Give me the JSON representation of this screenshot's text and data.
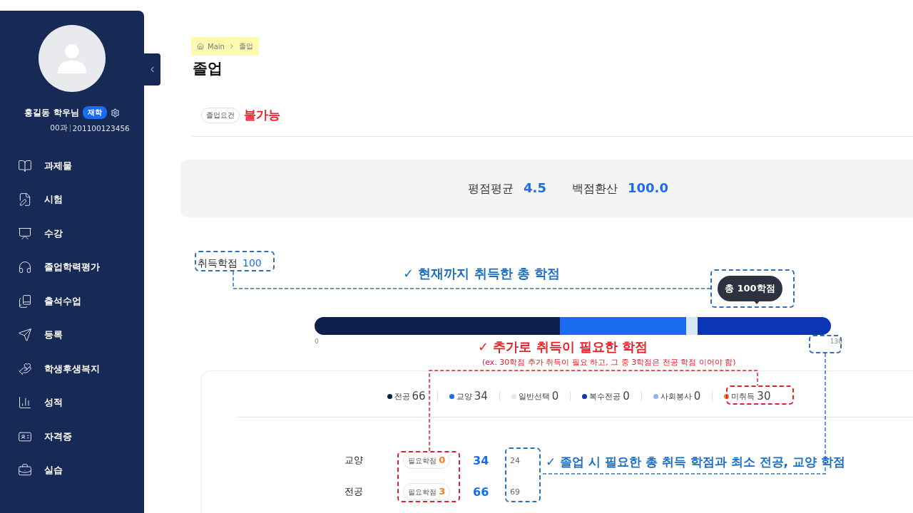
{
  "sidebar": {
    "profile": {
      "name": "홍길동 학우님",
      "badge": "재학",
      "department": "00과",
      "student_id": "201100123456"
    },
    "items": [
      {
        "label": "과제물"
      },
      {
        "label": "시험"
      },
      {
        "label": "수강"
      },
      {
        "label": "졸업학력평가"
      },
      {
        "label": "출석수업"
      },
      {
        "label": "등록"
      },
      {
        "label": "학생후생복지"
      },
      {
        "label": "성적"
      },
      {
        "label": "자격증"
      },
      {
        "label": "실습"
      }
    ]
  },
  "breadcrumb": [
    "Main",
    "졸업"
  ],
  "title": "졸업",
  "requirement": {
    "label": "졸업요건",
    "status": "불가능"
  },
  "grades": [
    {
      "label": "평점평균",
      "value": "4.5"
    },
    {
      "label": "백점환산",
      "value": "100.0"
    }
  ],
  "credits": {
    "label": "취득학점",
    "value": "100",
    "tooltip": "총 100학점",
    "min": "0",
    "max": "130",
    "segments": [
      {
        "color": "#0e1f4d"
      },
      {
        "color": "#1a6cf0"
      },
      {
        "color": "#d8e8fb"
      },
      {
        "color": "#0b35b5"
      }
    ]
  },
  "legend": [
    {
      "label": "전공",
      "value": "66",
      "color": "#0e1f4d"
    },
    {
      "label": "교양",
      "value": "34",
      "color": "#1a6cf0"
    },
    {
      "label": "일반선택",
      "value": "0",
      "color": "#d8e8fb"
    },
    {
      "label": "복수전공",
      "value": "0",
      "color": "#0b35b5"
    },
    {
      "label": "사회봉사",
      "value": "0",
      "color": "#8ab8f0"
    },
    {
      "label": "미취득",
      "value": "30",
      "color": "#f47b20"
    }
  ],
  "rows": [
    {
      "label": "교양",
      "pill_label": "필요학점",
      "pill_value": "0",
      "earned": "34",
      "required": "24"
    },
    {
      "label": "전공",
      "pill_label": "필요학점",
      "pill_value": "3",
      "earned": "66",
      "required": "69"
    }
  ],
  "annotations": [
    {
      "text": "✓ 현재까지 취득한 총 학점",
      "color": "#1b6ec2"
    },
    {
      "text": "✓ 추가로 취득이 필요한 학점",
      "color": "#e8202a"
    },
    {
      "text": "(ex. 30학점 추가 취득이 필요 하고, 그 중 3학점은 전공 학점 이어야 함)",
      "color": "#e8202a"
    },
    {
      "text": "✓ 졸업 시 필요한 총 취득 학점과 최소 전공, 교양 학점",
      "color": "#1b6ec2"
    }
  ]
}
